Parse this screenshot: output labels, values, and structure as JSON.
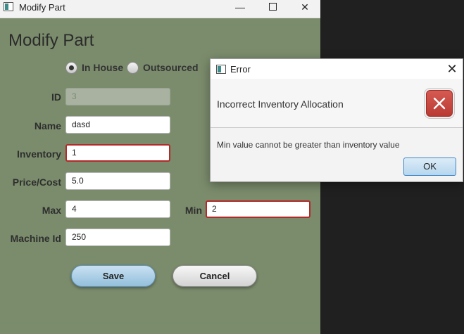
{
  "window": {
    "title": "Modify Part",
    "controls": {
      "minimize": "—",
      "close": "✕"
    }
  },
  "form": {
    "heading": "Modify Part",
    "radio": {
      "in_house": {
        "label": "In House",
        "selected": true
      },
      "outsourced": {
        "label": "Outsourced",
        "selected": false
      }
    },
    "fields": {
      "id": {
        "label": "ID",
        "value": "3"
      },
      "name": {
        "label": "Name",
        "value": "dasd"
      },
      "inventory": {
        "label": "Inventory",
        "value": "1"
      },
      "price": {
        "label": "Price/Cost",
        "value": "5.0"
      },
      "max": {
        "label": "Max",
        "value": "4"
      },
      "min": {
        "label": "Min",
        "value": "2"
      },
      "machine_id": {
        "label": "Machine Id",
        "value": "250"
      }
    },
    "buttons": {
      "save": "Save",
      "cancel": "Cancel"
    }
  },
  "dialog": {
    "title": "Error",
    "close": "✕",
    "header": "Incorrect Inventory Allocation",
    "content": "Min value cannot be greater than inventory value",
    "ok": "OK",
    "icon": "error-icon"
  },
  "colors": {
    "form_background": "#7b8c6c",
    "error_border": "#b22a2a",
    "save_button": "#93bfdc",
    "error_icon": "#c9473f"
  }
}
